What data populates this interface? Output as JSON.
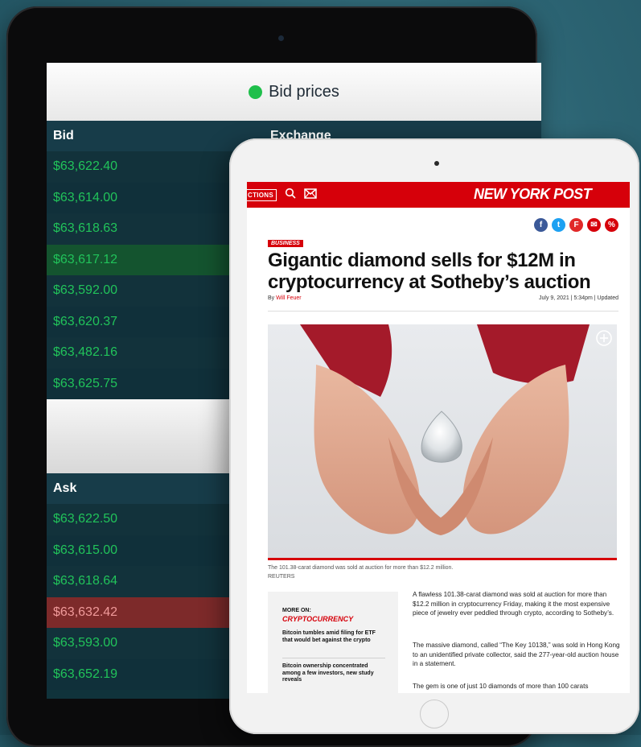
{
  "bid_screen": {
    "header_title": "Bid prices",
    "columns": [
      "Bid",
      "Exchange"
    ],
    "bid_rows": [
      "$63,622.40",
      "$63,614.00",
      "$63,618.63",
      "$63,617.12",
      "$63,592.00",
      "$63,620.37",
      "$63,482.16",
      "$63,625.75"
    ],
    "ask_header": "Ask",
    "ask_rows": [
      "$63,622.50",
      "$63,615.00",
      "$63,618.64",
      "$63,632.42",
      "$63,593.00",
      "$63,652.19"
    ],
    "colors": {
      "green_text": "#21c35a",
      "green_dot": "#1fbf4b",
      "highlight_green": "#14542f",
      "highlight_red": "#7d2a2a"
    }
  },
  "nyp": {
    "sections_label": "CTIONS",
    "search_icon": "search-icon",
    "mail_icon": "mail-icon",
    "logo": "NEW YORK POST",
    "share_icons": [
      "facebook-icon",
      "twitter-icon",
      "flipboard-icon",
      "email-icon",
      "link-icon"
    ],
    "tag": "BUSINESS",
    "headline": "Gigantic diamond sells for $12M in cryptocurrency at Sotheby’s auction",
    "by_prefix": "By ",
    "author": "Will Feuer",
    "date": "July 9, 2021 | 5:34pm | Updated",
    "caption": "The 101.38-carat diamond was sold at auction for more than $12.2 million.",
    "credit": "REUTERS",
    "more_on_label": "MORE ON:",
    "more_on_topic": "CRYPTOCURRENCY",
    "more_items": [
      "Bitcoin tumbles amid filing for ETF that would bet against the crypto",
      "Bitcoin ownership concentrated among a few investors, new study reveals"
    ],
    "paragraphs": [
      "A flawless 101.38-carat diamond was sold at auction for more than $12.2 million in cryptocurrency Friday, making it the most expensive piece of jewelry ever peddled through crypto, according to Sotheby’s.",
      "The massive diamond, called “The Key 10138,” was sold in Hong Kong to an unidentified private collector, said the 277-year-old auction house in a statement.",
      "The gem is one of just 10 diamonds of more than 100 carats"
    ],
    "accent": "#d6000a"
  }
}
